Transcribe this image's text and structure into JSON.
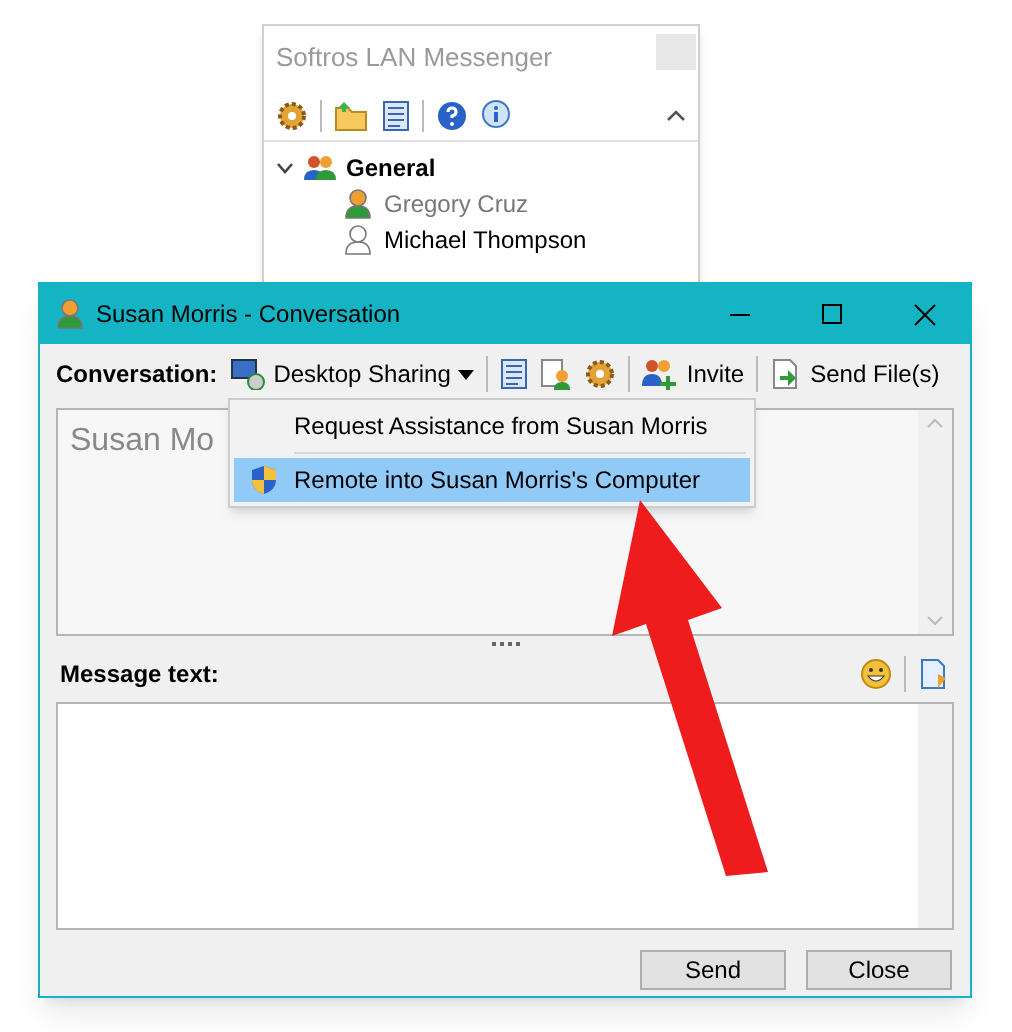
{
  "background_window": {
    "title": "Softros LAN Messenger",
    "group": {
      "name": "General",
      "expanded": true,
      "children": [
        {
          "name": "Gregory Cruz",
          "online": true
        },
        {
          "name": "Michael Thompson",
          "online": false
        }
      ]
    }
  },
  "conversation_window": {
    "title": "Susan Morris - Conversation",
    "toolbar": {
      "label": "Conversation:",
      "desktop_sharing": "Desktop Sharing",
      "invite": "Invite",
      "send_files": "Send File(s)"
    },
    "transcript": "Susan Mo",
    "dropdown_menu": [
      {
        "label": "Request Assistance from Susan Morris",
        "selected": false,
        "kind": "plain"
      },
      {
        "label": "Remote into Susan Morris's Computer",
        "selected": true,
        "kind": "shield"
      }
    ],
    "message_label": "Message text:",
    "buttons": [
      "Send",
      "Close"
    ]
  }
}
